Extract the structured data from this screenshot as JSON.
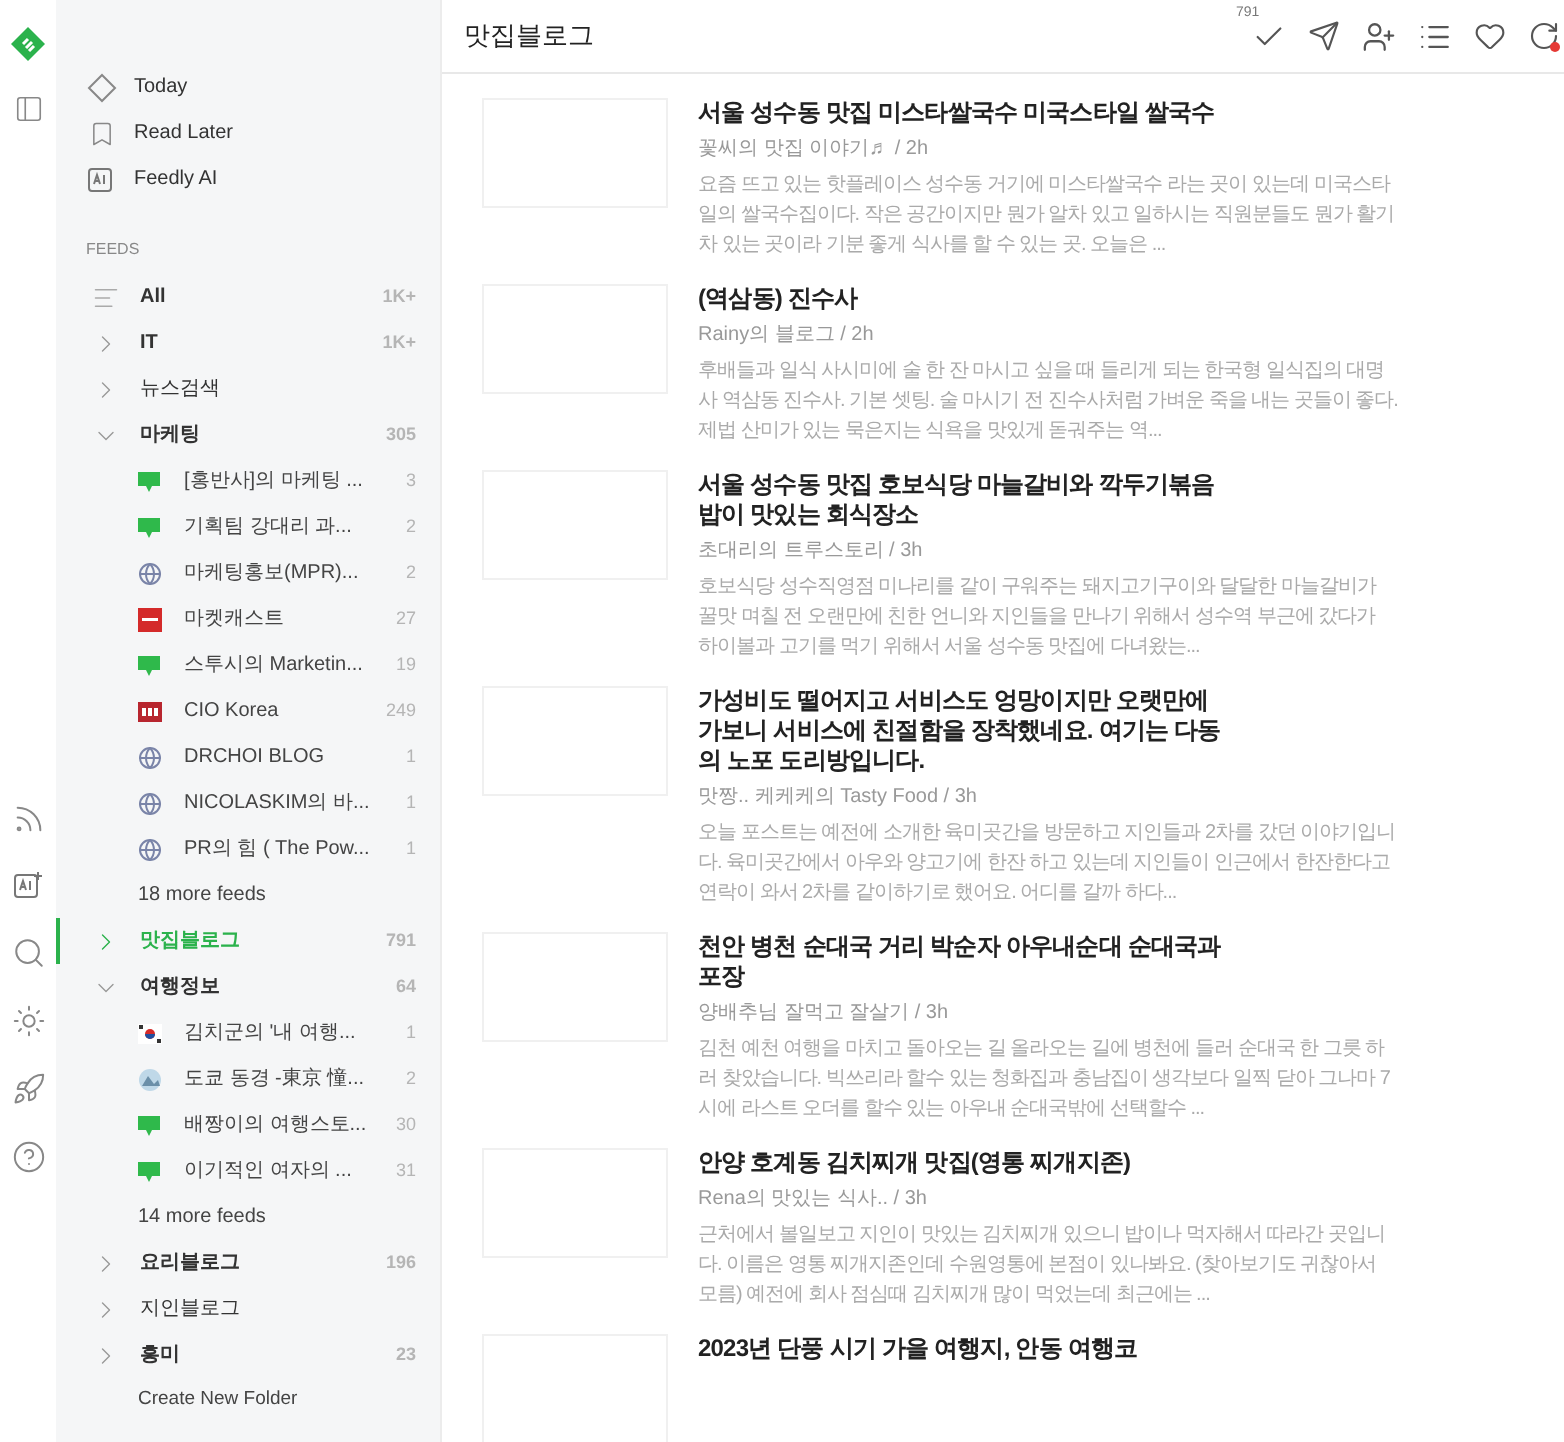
{
  "nav": [
    {
      "label": "Today",
      "kind": "today"
    },
    {
      "label": "Read Later",
      "kind": "bookmark"
    },
    {
      "label": "Feedly AI",
      "kind": "ai"
    }
  ],
  "feeds_heading": "FEEDS",
  "feeds": [
    {
      "label": "All",
      "kind": "all",
      "count": "1K+",
      "bold": true,
      "selected": false
    },
    {
      "label": "IT",
      "kind": "folder",
      "count": "1K+",
      "bold": true,
      "selected": false,
      "expanded": false
    },
    {
      "label": "뉴스검색",
      "kind": "folder",
      "bold": false,
      "selected": false,
      "expanded": false
    },
    {
      "label": "마케팅",
      "kind": "folder",
      "count": "305",
      "bold": true,
      "selected": false,
      "expanded": true,
      "more": "18 more feeds",
      "children": [
        {
          "label": "[홍반사]의 마케팅 ...",
          "count": "3",
          "kind": "blog"
        },
        {
          "label": "기획팀 강대리 과...",
          "count": "2",
          "kind": "blog"
        },
        {
          "label": "마케팅홍보(MPR)...",
          "count": "2",
          "kind": "globe"
        },
        {
          "label": "마켓캐스트",
          "count": "27",
          "kind": "red"
        },
        {
          "label": "스투시의 Marketin...",
          "count": "19",
          "kind": "blog"
        },
        {
          "label": "CIO Korea",
          "count": "249",
          "kind": "cio"
        },
        {
          "label": "DRCHOI BLOG",
          "count": "1",
          "kind": "globe"
        },
        {
          "label": "NICOLASKIM의 바...",
          "count": "1",
          "kind": "globe"
        },
        {
          "label": "PR의 힘 ( The Pow...",
          "count": "1",
          "kind": "globe"
        }
      ]
    },
    {
      "label": "맛집블로그",
      "kind": "folder",
      "count": "791",
      "bold": true,
      "selected": true,
      "expanded": false
    },
    {
      "label": "여행정보",
      "kind": "folder",
      "count": "64",
      "bold": true,
      "selected": false,
      "expanded": true,
      "more": "14 more feeds",
      "children": [
        {
          "label": "김치군의 '내 여행...",
          "count": "1",
          "kind": "flag"
        },
        {
          "label": "도쿄 동경 -東京 憧...",
          "count": "2",
          "kind": "image"
        },
        {
          "label": "배짱이의 여행스토...",
          "count": "30",
          "kind": "blog"
        },
        {
          "label": "이기적인 여자의 ...",
          "count": "31",
          "kind": "blog"
        }
      ]
    },
    {
      "label": "요리블로그",
      "kind": "folder",
      "count": "196",
      "bold": true,
      "selected": false,
      "expanded": false
    },
    {
      "label": "지인블로그",
      "kind": "folder",
      "bold": false,
      "selected": false,
      "expanded": false
    },
    {
      "label": "흥미",
      "kind": "folder",
      "count": "23",
      "bold": true,
      "selected": false,
      "expanded": false
    }
  ],
  "create_folder": "Create New Folder",
  "header": {
    "title": "맛집블로그",
    "unread_count": "791"
  },
  "articles": [
    {
      "title": "서울 성수동 맛집 미스타쌀국수 미국스타일 쌀국수",
      "meta": "꽃씨의 맛집 이야기♬ / 2h",
      "snippet": "요즘 뜨고 있는 핫플레이스 성수동 거기에 미스타쌀국수 라는 곳이 있는데 미국스타일의 쌀국수집이다. 작은 공간이지만 뭔가 알차 있고 일하시는 직원분들도 뭔가 활기차 있는 곳이라 기분 좋게 식사를 할 수 있는 곳. 오늘은 ..."
    },
    {
      "title": "(역삼동) 진수사",
      "meta": "Rainy의 블로그 / 2h",
      "snippet": "후배들과 일식 사시미에 술 한 잔 마시고 싶을 때 들리게 되는 한국형 일식집의 대명사 역삼동 진수사. 기본 셋팅. 술 마시기 전 진수사처럼 가벼운 죽을 내는 곳들이 좋다. 제법 산미가 있는 묵은지는 식욕을 맛있게 돋궈주는 역..."
    },
    {
      "title": "서울 성수동 맛집 호보식당 마늘갈비와 깍두기볶음밥이 맛있는 회식장소",
      "meta": "초대리의 트루스토리 / 3h",
      "snippet": "호보식당 성수직영점 미나리를 같이 구워주는 돼지고기구이와 달달한 마늘갈비가 꿀맛 며칠 전 오랜만에 친한 언니와 지인들을 만나기 위해서 성수역 부근에 갔다가 하이볼과 고기를 먹기 위해서 서울 성수동 맛집에 다녀왔는..."
    },
    {
      "title": "가성비도 떨어지고 서비스도 엉망이지만 오랫만에 가보니 서비스에 친절함을 장착했네요. 여기는 다동의 노포 도리방입니다.",
      "meta": "맛짱.. 케케케의 Tasty Food / 3h",
      "snippet": "오늘 포스트는 예전에 소개한 육미곳간을 방문하고 지인들과 2차를 갔던 이야기입니다. 육미곳간에서 아우와 양고기에 한잔 하고 있는데 지인들이 인근에서 한잔한다고 연락이 와서 2차를 같이하기로 했어요. 어디를 갈까 하다..."
    },
    {
      "title": "천안 병천 순대국 거리 박순자 아우내순대 순대국과 포장",
      "meta": "양배추님 잘먹고 잘살기 / 3h",
      "snippet": "김천 예천 여행을 마치고 돌아오는 길 올라오는 길에 병천에 들러 순대국 한 그릇 하러 찾았습니다. 빅쓰리라 할수 있는 청화집과 충남집이 생각보다 일찍 닫아 그나마 7시에 라스트 오더를 할수 있는 아우내 순대국밖에 선택할수 ..."
    },
    {
      "title": "안양 호계동 김치찌개 맛집(영통 찌개지존)",
      "meta": "Rena의 맛있는 식사.. / 3h",
      "snippet": "근처에서 볼일보고 지인이 맛있는 김치찌개 있으니 밥이나 먹자해서 따라간 곳입니다. 이름은 영통 찌개지존인데 수원영통에 본점이 있나봐요. (찾아보기도 귀찮아서 모름) 예전에 회사 점심때 김치찌개 많이 먹었는데 최근에는 ..."
    },
    {
      "title": "2023년 단풍 시기 가을 여행지, 안동 여행코"
    }
  ]
}
